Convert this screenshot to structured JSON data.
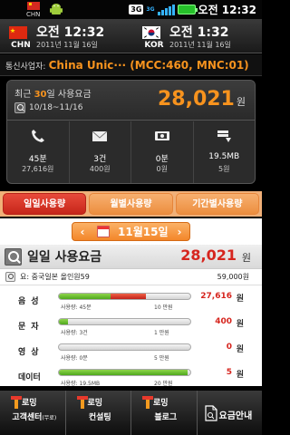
{
  "status_bar": {
    "left_flag_code": "CHN",
    "net_badge": "3G",
    "net_small": "3G",
    "time": "오전 12:32"
  },
  "clocks": [
    {
      "code": "CHN",
      "time": "오전 12:32",
      "date": "2011년 11월 16일"
    },
    {
      "code": "KOR",
      "time": "오전 1:32",
      "date": "2011년 11월 16일"
    }
  ],
  "carrier": {
    "label": "통신사업자:",
    "value": "China Unic···  (MCC:460, MNC:01)"
  },
  "summary": {
    "label_prefix": "최근 ",
    "label_days": "30",
    "label_suffix": "일 사용요금",
    "period": "10/18~11/16",
    "amount": "28,021",
    "unit": "원",
    "stats": [
      {
        "icon": "phone-icon",
        "v1": "45분",
        "v2": "27,616원"
      },
      {
        "icon": "envelope-icon",
        "v1": "3건",
        "v2": "400원"
      },
      {
        "icon": "video-icon",
        "v1": "0분",
        "v2": "0원"
      },
      {
        "icon": "data-download-icon",
        "v1": "19.5MB",
        "v2": "5원"
      }
    ]
  },
  "tabs": [
    "일일사용량",
    "월별사용량",
    "기간별사용량"
  ],
  "date_nav": {
    "date": "11월15일",
    "prev": "‹",
    "next": "›"
  },
  "daily": {
    "title": "일일 사용요금",
    "amount": "28,021",
    "unit": "원"
  },
  "plan": {
    "name": "요: 중국일본 올인원59",
    "amount": "59,000원"
  },
  "usage": [
    {
      "label": "음성",
      "used_label": "사용량: 45분",
      "max_label": "10 만원",
      "amount": "27,616",
      "unit": "원",
      "green_fraction": 0.39,
      "red_fraction": 0.27
    },
    {
      "label": "문자",
      "used_label": "사용량: 3건",
      "max_label": "1 만원",
      "amount": "400",
      "unit": "원",
      "green_fraction": 0.07,
      "red_fraction": 0.0
    },
    {
      "label": "영상",
      "used_label": "사용량: 0분",
      "max_label": "5 만원",
      "amount": "0",
      "unit": "원",
      "green_fraction": 0.0,
      "red_fraction": 0.0
    },
    {
      "label": "데이터",
      "used_label": "사용량: 19.5MB",
      "max_label": "20 만원",
      "amount": "5",
      "unit": "원",
      "green_fraction": 0.98,
      "red_fraction": 0.0
    }
  ],
  "bottom_nav": [
    {
      "top": "로밍",
      "bottom": "고객센터",
      "small": "(무료)"
    },
    {
      "top": "로밍",
      "bottom": "컨설팅",
      "small": ""
    },
    {
      "top": "로밍",
      "bottom": "블로그",
      "small": ""
    },
    {
      "top": "",
      "bottom": "요금안내",
      "small": ""
    }
  ],
  "colors": {
    "accent": "#f7931e",
    "alert": "#d6251e",
    "usage_green": "#5bb525",
    "tab_active": "#d6301f"
  }
}
